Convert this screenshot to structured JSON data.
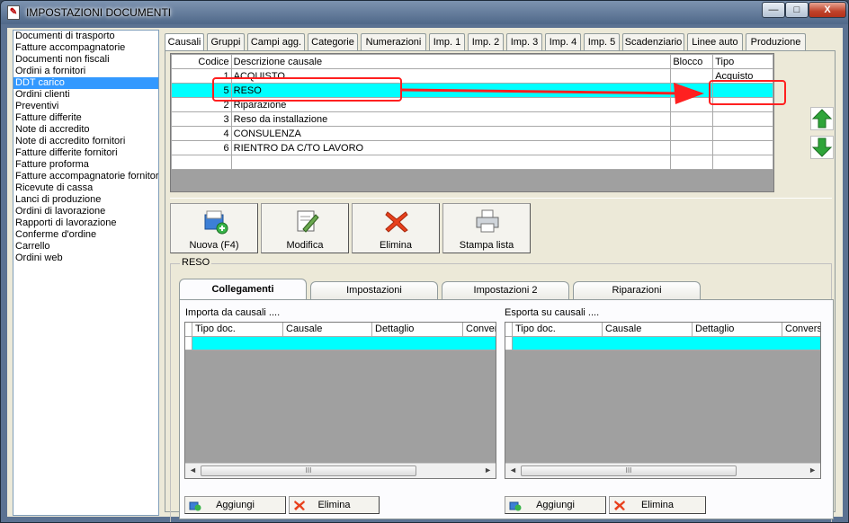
{
  "window": {
    "title": "IMPOSTAZIONI DOCUMENTI",
    "controls": {
      "minimize": "—",
      "maximize": "□",
      "close": "X"
    }
  },
  "doc_list": [
    "Documenti di trasporto",
    "Fatture accompagnatorie",
    "Documenti non fiscali",
    "Ordini a fornitori",
    "DDT carico",
    "Ordini clienti",
    "Preventivi",
    "Fatture differite",
    "Note di accredito",
    "Note di accredito fornitori",
    "Fatture differite fornitori",
    "Fatture proforma",
    "Fatture accompagnatorie fornitori",
    "Ricevute di cassa",
    "Lanci di produzione",
    "Ordini di lavorazione",
    "Rapporti di lavorazione",
    "Conferme d'ordine",
    "Carrello",
    "Ordini web"
  ],
  "selected_doc": "DDT carico",
  "tabs": [
    "Causali",
    "Gruppi",
    "Campi agg.",
    "Categorie",
    "Numerazioni",
    "Imp. 1",
    "Imp. 2",
    "Imp. 3",
    "Imp. 4",
    "Imp. 5",
    "Scadenziario",
    "Linee auto",
    "Produzione"
  ],
  "active_tab": "Causali",
  "causali_grid": {
    "headers": {
      "code": "Codice",
      "desc": "Descrizione causale",
      "blocco": "Blocco",
      "tipo": "Tipo"
    },
    "rows": [
      {
        "code": "1",
        "desc": "ACQUISTO",
        "blocco": "",
        "tipo": "Acquisto"
      },
      {
        "code": "5",
        "desc": "RESO",
        "blocco": "",
        "tipo": ""
      },
      {
        "code": "2",
        "desc": "Riparazione",
        "blocco": "",
        "tipo": ""
      },
      {
        "code": "3",
        "desc": "Reso da installazione",
        "blocco": "",
        "tipo": ""
      },
      {
        "code": "4",
        "desc": "CONSULENZA",
        "blocco": "",
        "tipo": ""
      },
      {
        "code": "6",
        "desc": "RIENTRO DA C/TO LAVORO",
        "blocco": "",
        "tipo": ""
      },
      {
        "code": "",
        "desc": "",
        "blocco": "",
        "tipo": ""
      }
    ],
    "selected_row": 1
  },
  "side_buttons": {
    "up": "arrow-up-icon",
    "down": "arrow-down-icon"
  },
  "toolbar": {
    "new": "Nuova (F4)",
    "edit": "Modifica",
    "delete": "Elimina",
    "print": "Stampa lista"
  },
  "detail": {
    "group_title": "RESO",
    "subtabs": [
      "Collegamenti",
      "Impostazioni",
      "Impostazioni 2",
      "Riparazioni"
    ],
    "active_subtab": "Collegamenti",
    "import": {
      "label": "Importa da causali ....",
      "columns": [
        "Tipo doc.",
        "Causale",
        "Dettaglio",
        "Conver"
      ],
      "add": "Aggiungi",
      "remove": "Elimina"
    },
    "export": {
      "label": "Esporta su causali ....",
      "columns": [
        "Tipo doc.",
        "Causale",
        "Dettaglio",
        "Conversi"
      ],
      "add": "Aggiungi",
      "remove": "Elimina"
    },
    "scroll_grip": "III"
  },
  "colors": {
    "selection": "#00ffff",
    "list_selection": "#3399ff",
    "annotation": "#ff2020",
    "arrow_green": "#2fa53a"
  }
}
